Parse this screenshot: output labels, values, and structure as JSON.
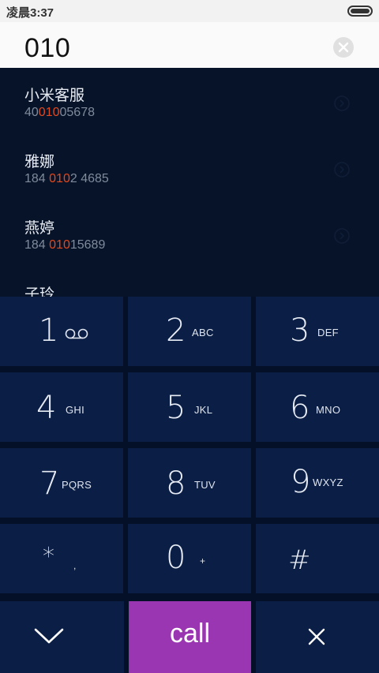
{
  "status_bar": {
    "time": "凌晨3:37",
    "battery_icon": "battery-full-icon"
  },
  "dial_input": {
    "value": "010",
    "clear_icon": "clear-circle-x-icon"
  },
  "results": [
    {
      "name": "小米客服",
      "number_pre": "40",
      "number_match": "010",
      "number_post": "05678"
    },
    {
      "name": "雅娜",
      "number_pre": "184 ",
      "number_match": "010",
      "number_post": "2 4685"
    },
    {
      "name": "燕婷",
      "number_pre": "184 ",
      "number_match": "010",
      "number_post": "15689"
    },
    {
      "name": "子玲"
    }
  ],
  "keypad": {
    "k1": {
      "digit": "1",
      "icon": "voicemail-icon"
    },
    "k2": {
      "digit": "2",
      "letters": "ABC"
    },
    "k3": {
      "digit": "3",
      "letters": "DEF"
    },
    "k4": {
      "digit": "4",
      "letters": "GHI"
    },
    "k5": {
      "digit": "5",
      "letters": "JKL"
    },
    "k6": {
      "digit": "6",
      "letters": "MNO"
    },
    "k7": {
      "digit": "7",
      "letters": "PQRS"
    },
    "k8": {
      "digit": "8",
      "letters": "TUV"
    },
    "k9": {
      "digit": "9",
      "letters": "WXYZ"
    },
    "kstar": {
      "digit": "*",
      "sub": ","
    },
    "k0": {
      "digit": "0",
      "sub": "+"
    },
    "khash": {
      "digit": "#"
    }
  },
  "actions": {
    "collapse_icon": "chevron-down-icon",
    "call_label": "call",
    "delete_icon": "close-x-icon"
  },
  "colors": {
    "background": "#071329",
    "key": "#0b1e45",
    "call": "#9b36b2",
    "highlight": "#e04a1f"
  }
}
